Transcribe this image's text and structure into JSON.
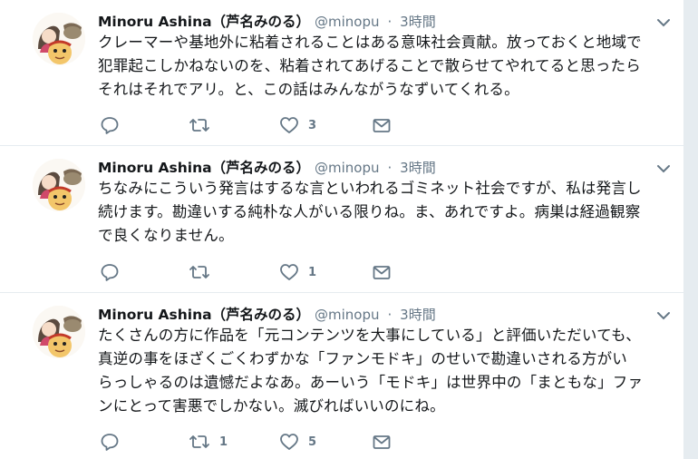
{
  "colors": {
    "text": "#14171a",
    "muted": "#657786",
    "divider": "#e6ecf0",
    "background": "#e6ecf0"
  },
  "icons": [
    "reply-icon",
    "retweet-icon",
    "like-icon",
    "message-icon",
    "chevron-down-icon"
  ],
  "tweets": [
    {
      "name": "Minoru Ashina（芦名みのる）",
      "handle": "@minopu",
      "separator": "·",
      "time": "3時間",
      "text": "クレーマーや基地外に粘着されることはある意味社会貢献。放っておくと地域で\n犯罪起こしかねないのを、粘着されてあげることで散らせてやれてると思ったら\nそれはそれでアリ。と、この話はみんながうなずいてくれる。",
      "replies": "",
      "retweets": "",
      "likes": "3"
    },
    {
      "name": "Minoru Ashina（芦名みのる）",
      "handle": "@minopu",
      "separator": "·",
      "time": "3時間",
      "text": "ちなみにこういう発言はするな言といわれるゴミネット社会ですが、私は発言し\n続けます。勘違いする純朴な人がいる限りね。ま、あれですよ。病巣は経過観察\nで良くなりません。",
      "replies": "",
      "retweets": "",
      "likes": "1"
    },
    {
      "name": "Minoru Ashina（芦名みのる）",
      "handle": "@minopu",
      "separator": "·",
      "time": "3時間",
      "text": "たくさんの方に作品を「元コンテンツを大事にしている」と評価いただいても、\n真逆の事をほざくごくわずかな「ファンモドキ」のせいで勘違いされる方がい\nらっしゃるのは遺憾だよなあ。あーいう「モドキ」は世界中の「まともな」ファ\nンにとって害悪でしかない。滅びればいいのにね。",
      "replies": "",
      "retweets": "1",
      "likes": "5"
    }
  ]
}
